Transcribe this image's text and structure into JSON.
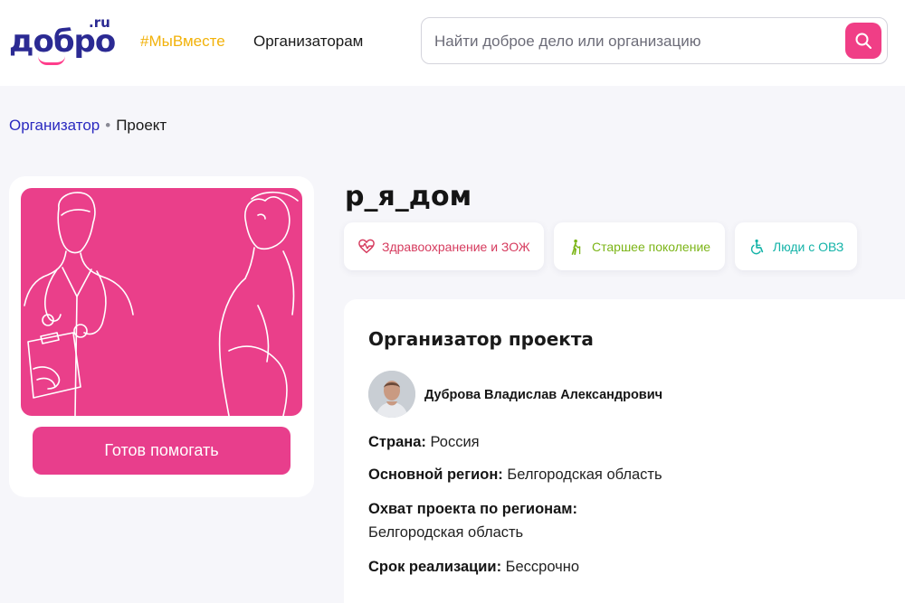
{
  "header": {
    "logo_main": "добро",
    "logo_suffix": ".ru",
    "nav": [
      {
        "label": "#МыВместе",
        "color": "#f2b20a"
      },
      {
        "label": "Организаторам"
      }
    ],
    "search": {
      "placeholder": "Найти доброе дело или организацию",
      "value": ""
    }
  },
  "breadcrumb": {
    "parent": "Организатор",
    "current": "Проект"
  },
  "project": {
    "title": "р_я_дом",
    "help_button": "Готов помогать",
    "tags": [
      {
        "label": "Здравоохранение и ЗОЖ",
        "icon": "heart-pulse-icon",
        "color": "#d63b5e"
      },
      {
        "label": "Старшее поколение",
        "icon": "elderly-person-icon",
        "color": "#7cb518"
      },
      {
        "label": "Люди с ОВЗ",
        "icon": "wheelchair-icon",
        "color": "#14b3a8"
      }
    ]
  },
  "organizer": {
    "heading": "Организатор проекта",
    "name": "Дуброва Владислав Александрович",
    "country_label": "Страна:",
    "country": "Россия",
    "region_label": "Основной регион:",
    "region": "Белгородская область",
    "coverage_label": "Охват проекта по регионам:",
    "coverage": "Белгородская область",
    "term_label": "Срок реализации:",
    "term": "Бессрочно"
  },
  "colors": {
    "brand": "#2b2a93",
    "accent": "#e83e8c",
    "background": "#f6f6fa"
  }
}
